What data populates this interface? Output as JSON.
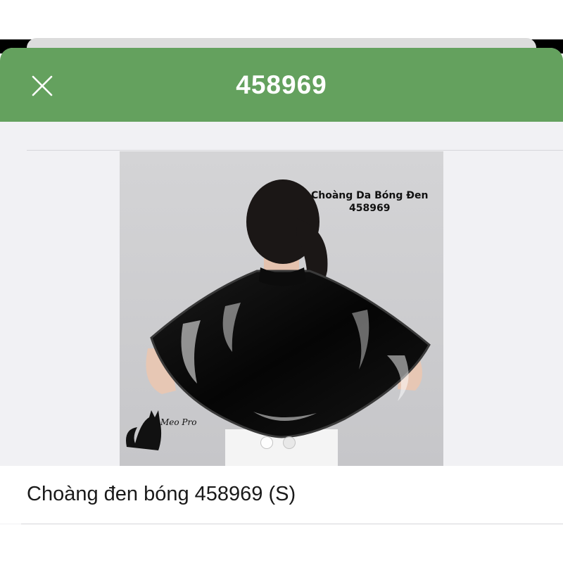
{
  "header": {
    "title": "458969",
    "close_icon": "close-icon",
    "background_color": "#64a15e"
  },
  "image": {
    "caption_line1": "Choàng Da Bóng Đen",
    "caption_line2": "458969",
    "signature": "Meo Pro",
    "carousel_total": 2,
    "carousel_active": 1
  },
  "product": {
    "name": "Choàng đen bóng 458969 (S)"
  }
}
